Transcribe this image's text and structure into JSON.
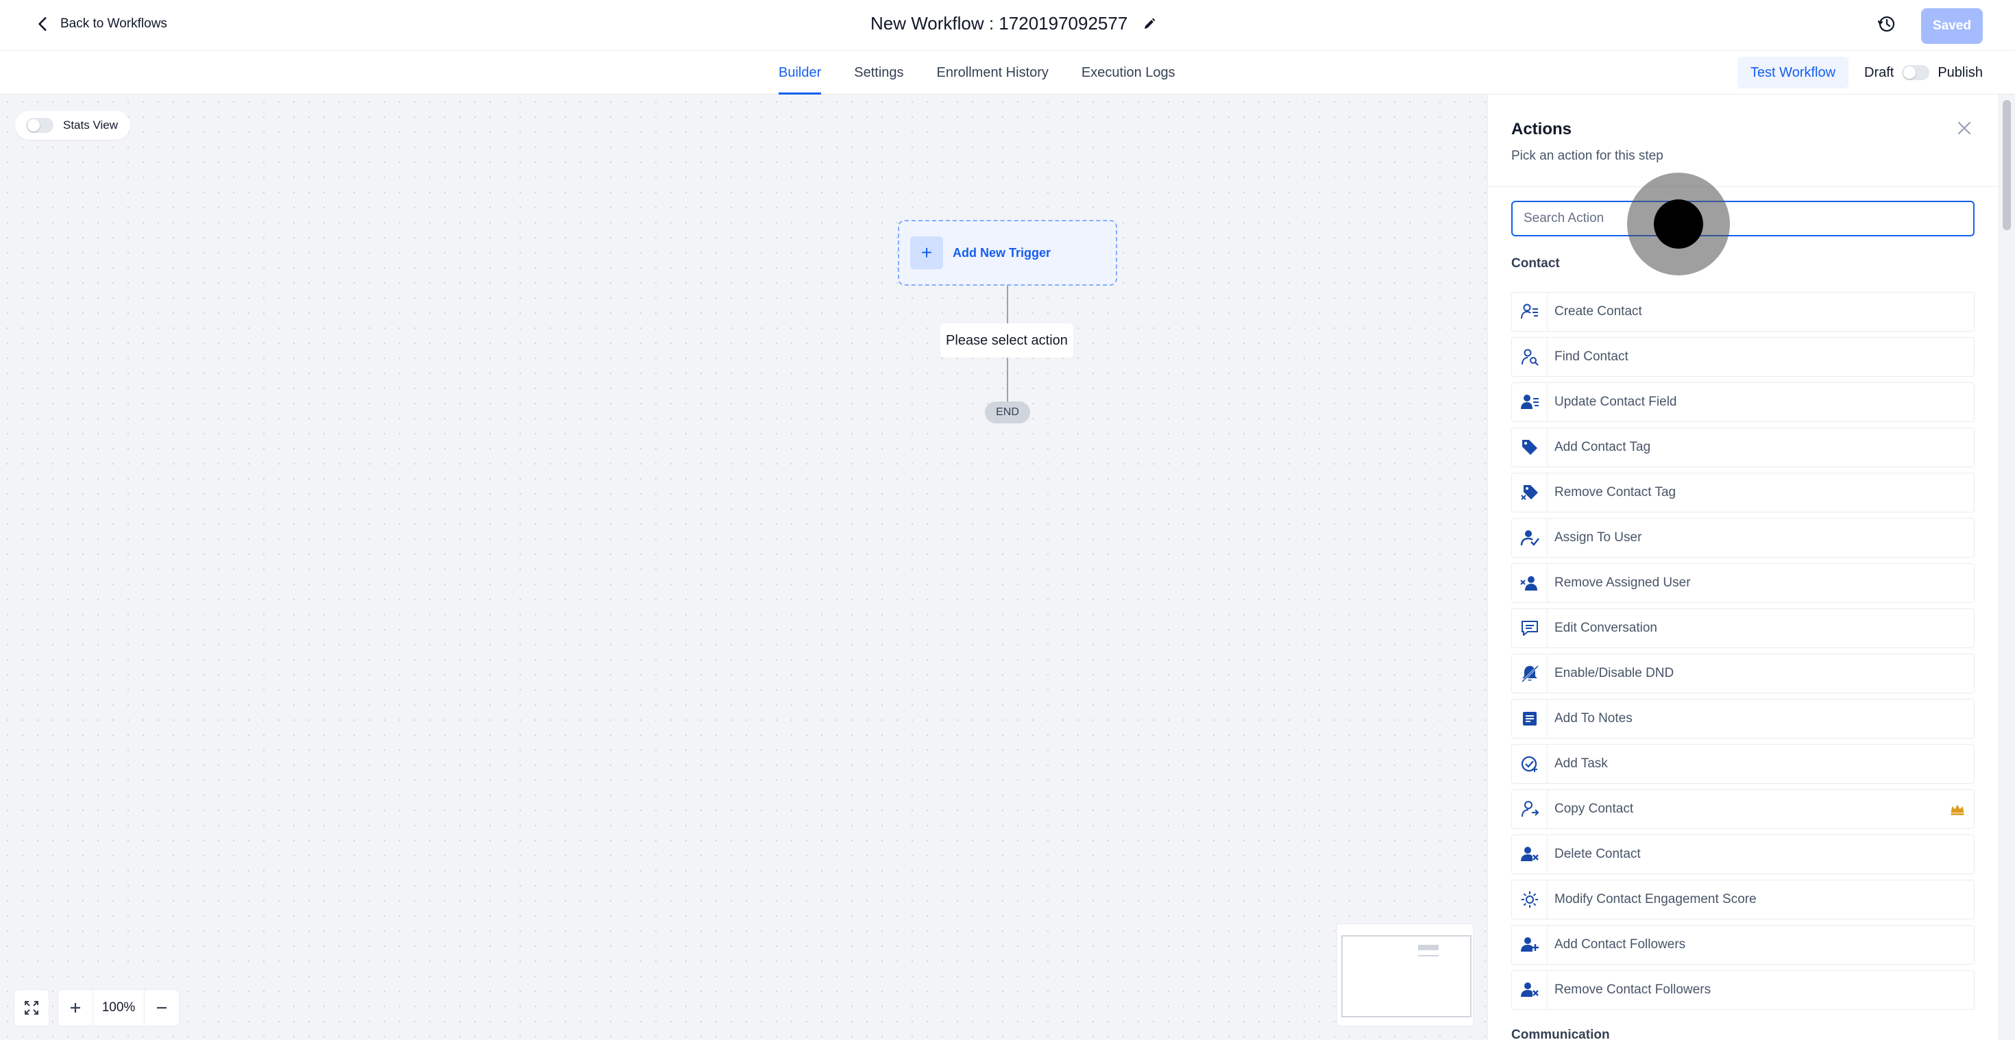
{
  "header": {
    "back_label": "Back to Workflows",
    "workflow_title": "New Workflow : 1720197092577",
    "saved_label": "Saved"
  },
  "tabs": [
    {
      "label": "Builder",
      "active": true
    },
    {
      "label": "Settings",
      "active": false
    },
    {
      "label": "Enrollment History",
      "active": false
    },
    {
      "label": "Execution Logs",
      "active": false
    }
  ],
  "toolbar": {
    "test_label": "Test Workflow",
    "draft_label": "Draft",
    "publish_label": "Publish"
  },
  "canvas": {
    "stats_view_label": "Stats View",
    "trigger_label": "Add New Trigger",
    "select_action_label": "Please select action",
    "end_label": "END",
    "zoom_level": "100%"
  },
  "panel": {
    "title": "Actions",
    "subtitle": "Pick an action for this step",
    "search_placeholder": "Search Action",
    "section_contact": "Contact",
    "section_communication": "Communication",
    "actions": [
      {
        "label": "Create Contact",
        "icon": "user-lines-icon"
      },
      {
        "label": "Find Contact",
        "icon": "user-search-icon"
      },
      {
        "label": "Update Contact Field",
        "icon": "user-edit-icon"
      },
      {
        "label": "Add Contact Tag",
        "icon": "tag-icon"
      },
      {
        "label": "Remove Contact Tag",
        "icon": "tag-remove-icon"
      },
      {
        "label": "Assign To User",
        "icon": "user-assign-icon"
      },
      {
        "label": "Remove Assigned User",
        "icon": "user-remove-icon"
      },
      {
        "label": "Edit Conversation",
        "icon": "message-icon"
      },
      {
        "label": "Enable/Disable DND",
        "icon": "bell-off-icon"
      },
      {
        "label": "Add To Notes",
        "icon": "note-icon"
      },
      {
        "label": "Add Task",
        "icon": "task-check-icon"
      },
      {
        "label": "Copy Contact",
        "icon": "user-copy-icon",
        "premium": true
      },
      {
        "label": "Delete Contact",
        "icon": "user-delete-icon"
      },
      {
        "label": "Modify Contact Engagement Score",
        "icon": "sun-icon"
      },
      {
        "label": "Add Contact Followers",
        "icon": "user-plus-icon"
      },
      {
        "label": "Remove Contact Followers",
        "icon": "user-x-icon"
      }
    ]
  },
  "colors": {
    "accent": "#155eef",
    "icon_blue": "#1849a9",
    "premium": "#dc9b1b"
  }
}
